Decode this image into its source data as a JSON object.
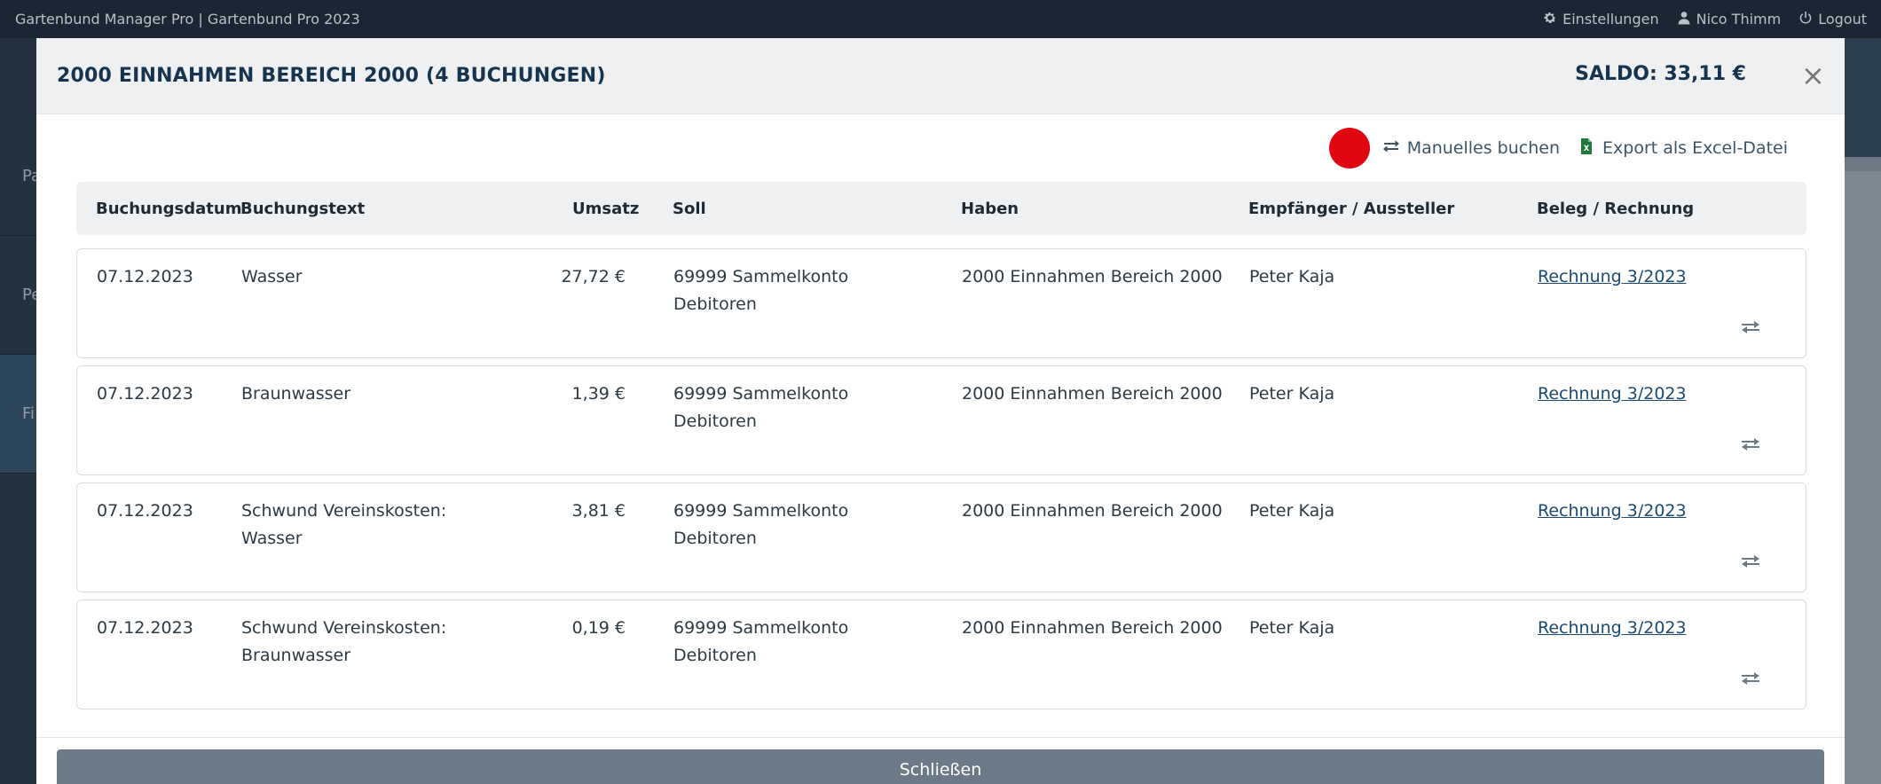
{
  "topbar": {
    "title": "Gartenbund Manager Pro | Gartenbund Pro 2023",
    "settings": "Einstellungen",
    "user": "Nico Thimm",
    "logout": "Logout"
  },
  "background": {
    "side_labels": [
      "Pa",
      "Pe",
      "Fi"
    ]
  },
  "modal": {
    "title": "2000 EINNAHMEN BEREICH 2000 (4 BUCHUNGEN)",
    "saldo": "SALDO: 33,11 €",
    "close_symbol": "×",
    "toolbar": {
      "manual_booking": "Manuelles buchen",
      "export_excel": "Export als Excel-Datei"
    },
    "columns": {
      "date": "Buchungsdatum",
      "text": "Buchungstext",
      "amount": "Umsatz",
      "debit": "Soll",
      "credit": "Haben",
      "recipient": "Empfänger / Aussteller",
      "voucher": "Beleg / Rechnung"
    },
    "rows": [
      {
        "date": "07.12.2023",
        "text_1": "Wasser",
        "text_2": "",
        "amount": "27,72 €",
        "debit_1": "69999 Sammelkonto",
        "debit_2": "Debitoren",
        "credit": "2000 Einnahmen Bereich 2000",
        "recipient": "Peter Kaja",
        "voucher": "Rechnung 3/2023"
      },
      {
        "date": "07.12.2023",
        "text_1": "Braunwasser",
        "text_2": "",
        "amount": "1,39 €",
        "debit_1": "69999 Sammelkonto",
        "debit_2": "Debitoren",
        "credit": "2000 Einnahmen Bereich 2000",
        "recipient": "Peter Kaja",
        "voucher": "Rechnung 3/2023"
      },
      {
        "date": "07.12.2023",
        "text_1": "Schwund Vereinskosten:",
        "text_2": "Wasser",
        "amount": "3,81 €",
        "debit_1": "69999 Sammelkonto",
        "debit_2": "Debitoren",
        "credit": "2000 Einnahmen Bereich 2000",
        "recipient": "Peter Kaja",
        "voucher": "Rechnung 3/2023"
      },
      {
        "date": "07.12.2023",
        "text_1": "Schwund Vereinskosten:",
        "text_2": "Braunwasser",
        "amount": "0,19 €",
        "debit_1": "69999 Sammelkonto",
        "debit_2": "Debitoren",
        "credit": "2000 Einnahmen Bereich 2000",
        "recipient": "Peter Kaja",
        "voucher": "Rechnung 3/2023"
      }
    ],
    "footer": {
      "close_label": "Schließen"
    }
  },
  "colors": {
    "record_dot": "#e20613",
    "header_text": "#16344f",
    "excel_green": "#1e7a3c",
    "link": "#1c4a73"
  }
}
